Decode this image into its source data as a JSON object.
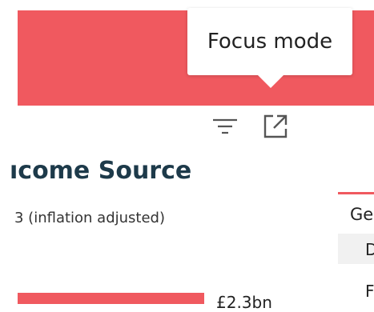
{
  "tooltip": {
    "text": "Focus mode"
  },
  "toolbar": {
    "filter_icon": "filter-icon",
    "focus_icon": "focus-mode-icon"
  },
  "card": {
    "title": "ıcome Source",
    "subtitle": "3 (inflation adjusted)",
    "bar_label": "£2.3bn"
  },
  "side_table": {
    "header": "Ge",
    "rows": [
      "D",
      "F"
    ]
  },
  "colors": {
    "accent": "#f0595f",
    "title": "#1d3a4a"
  }
}
